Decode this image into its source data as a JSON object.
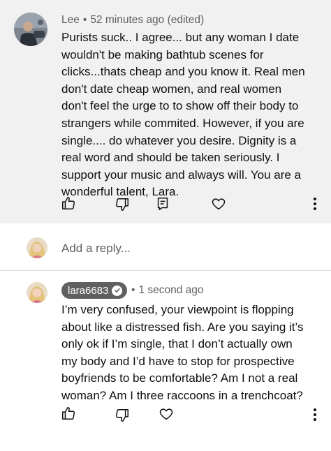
{
  "comment": {
    "author": "Lee",
    "separator": "•",
    "timestamp": "52 minutes ago (edited)",
    "lines": [
      "Purists suck.. I agree... but any woman I date",
      "wouldn't be making bathtub scenes for",
      "clicks...thats cheap and you know it. Real men",
      "don't date cheap women, and real women",
      "don't feel the urge to to show off their body to",
      "strangers while commited. However, if you are",
      "single.... do whatever you desire. Dignity is a",
      "real word and should be taken seriously. I",
      "support your music and always will. You are a",
      "wonderful talent, Lara."
    ],
    "actions": {
      "like_icon": "thumbs-up-icon",
      "dislike_icon": "thumbs-down-icon",
      "reply_icon": "comment-icon",
      "heart_icon": "heart-icon",
      "more_icon": "more-vertical-icon"
    }
  },
  "reply_box": {
    "placeholder": "Add a reply..."
  },
  "reply": {
    "author": "lara6683",
    "verified": true,
    "separator": "•",
    "timestamp": "1 second ago",
    "lines": [
      "I’m very confused, your viewpoint is flopping",
      "about like a distressed fish. Are you saying it’s",
      "only ok if I’m single, that I don’t actually own",
      "my body and I’d have to stop for prospective",
      "boyfriends to be comfortable? Am I not a real",
      "woman? Am I three raccoons in a trenchcoat?"
    ]
  },
  "colors": {
    "comment_background": "#f1f1f1",
    "secondary_text": "#606060",
    "author_badge": "#606060",
    "divider": "#dcdcdc"
  }
}
